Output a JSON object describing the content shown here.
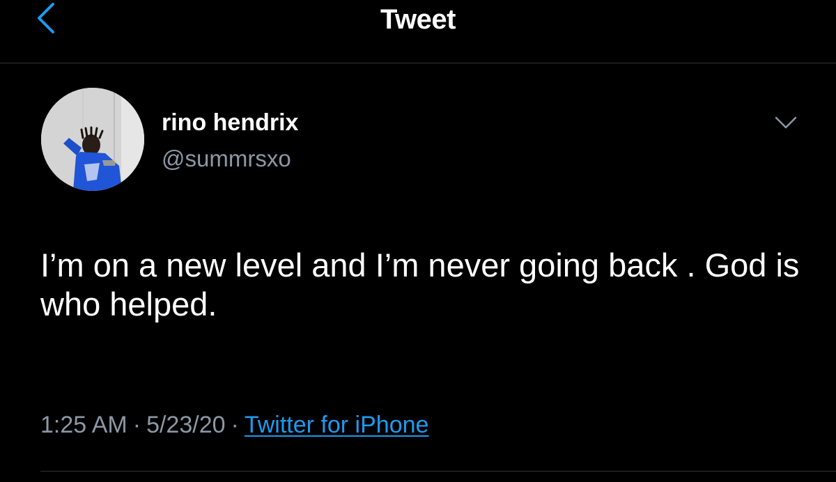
{
  "header": {
    "title": "Tweet",
    "back_icon": "chevron-left-icon"
  },
  "tweet": {
    "author": {
      "display_name": "rino hendrix",
      "handle": "@summrsxo"
    },
    "menu_icon": "chevron-down-icon",
    "text": "I’m on a new level and I’m never going back . God is who helped.",
    "time": "1:25 AM",
    "separator": "·",
    "date": "5/23/20",
    "source": "Twitter for iPhone"
  },
  "colors": {
    "background": "#000000",
    "text_primary": "#ffffff",
    "text_secondary": "#8b98a5",
    "accent": "#1d9bf0",
    "divider": "#2f3336"
  }
}
